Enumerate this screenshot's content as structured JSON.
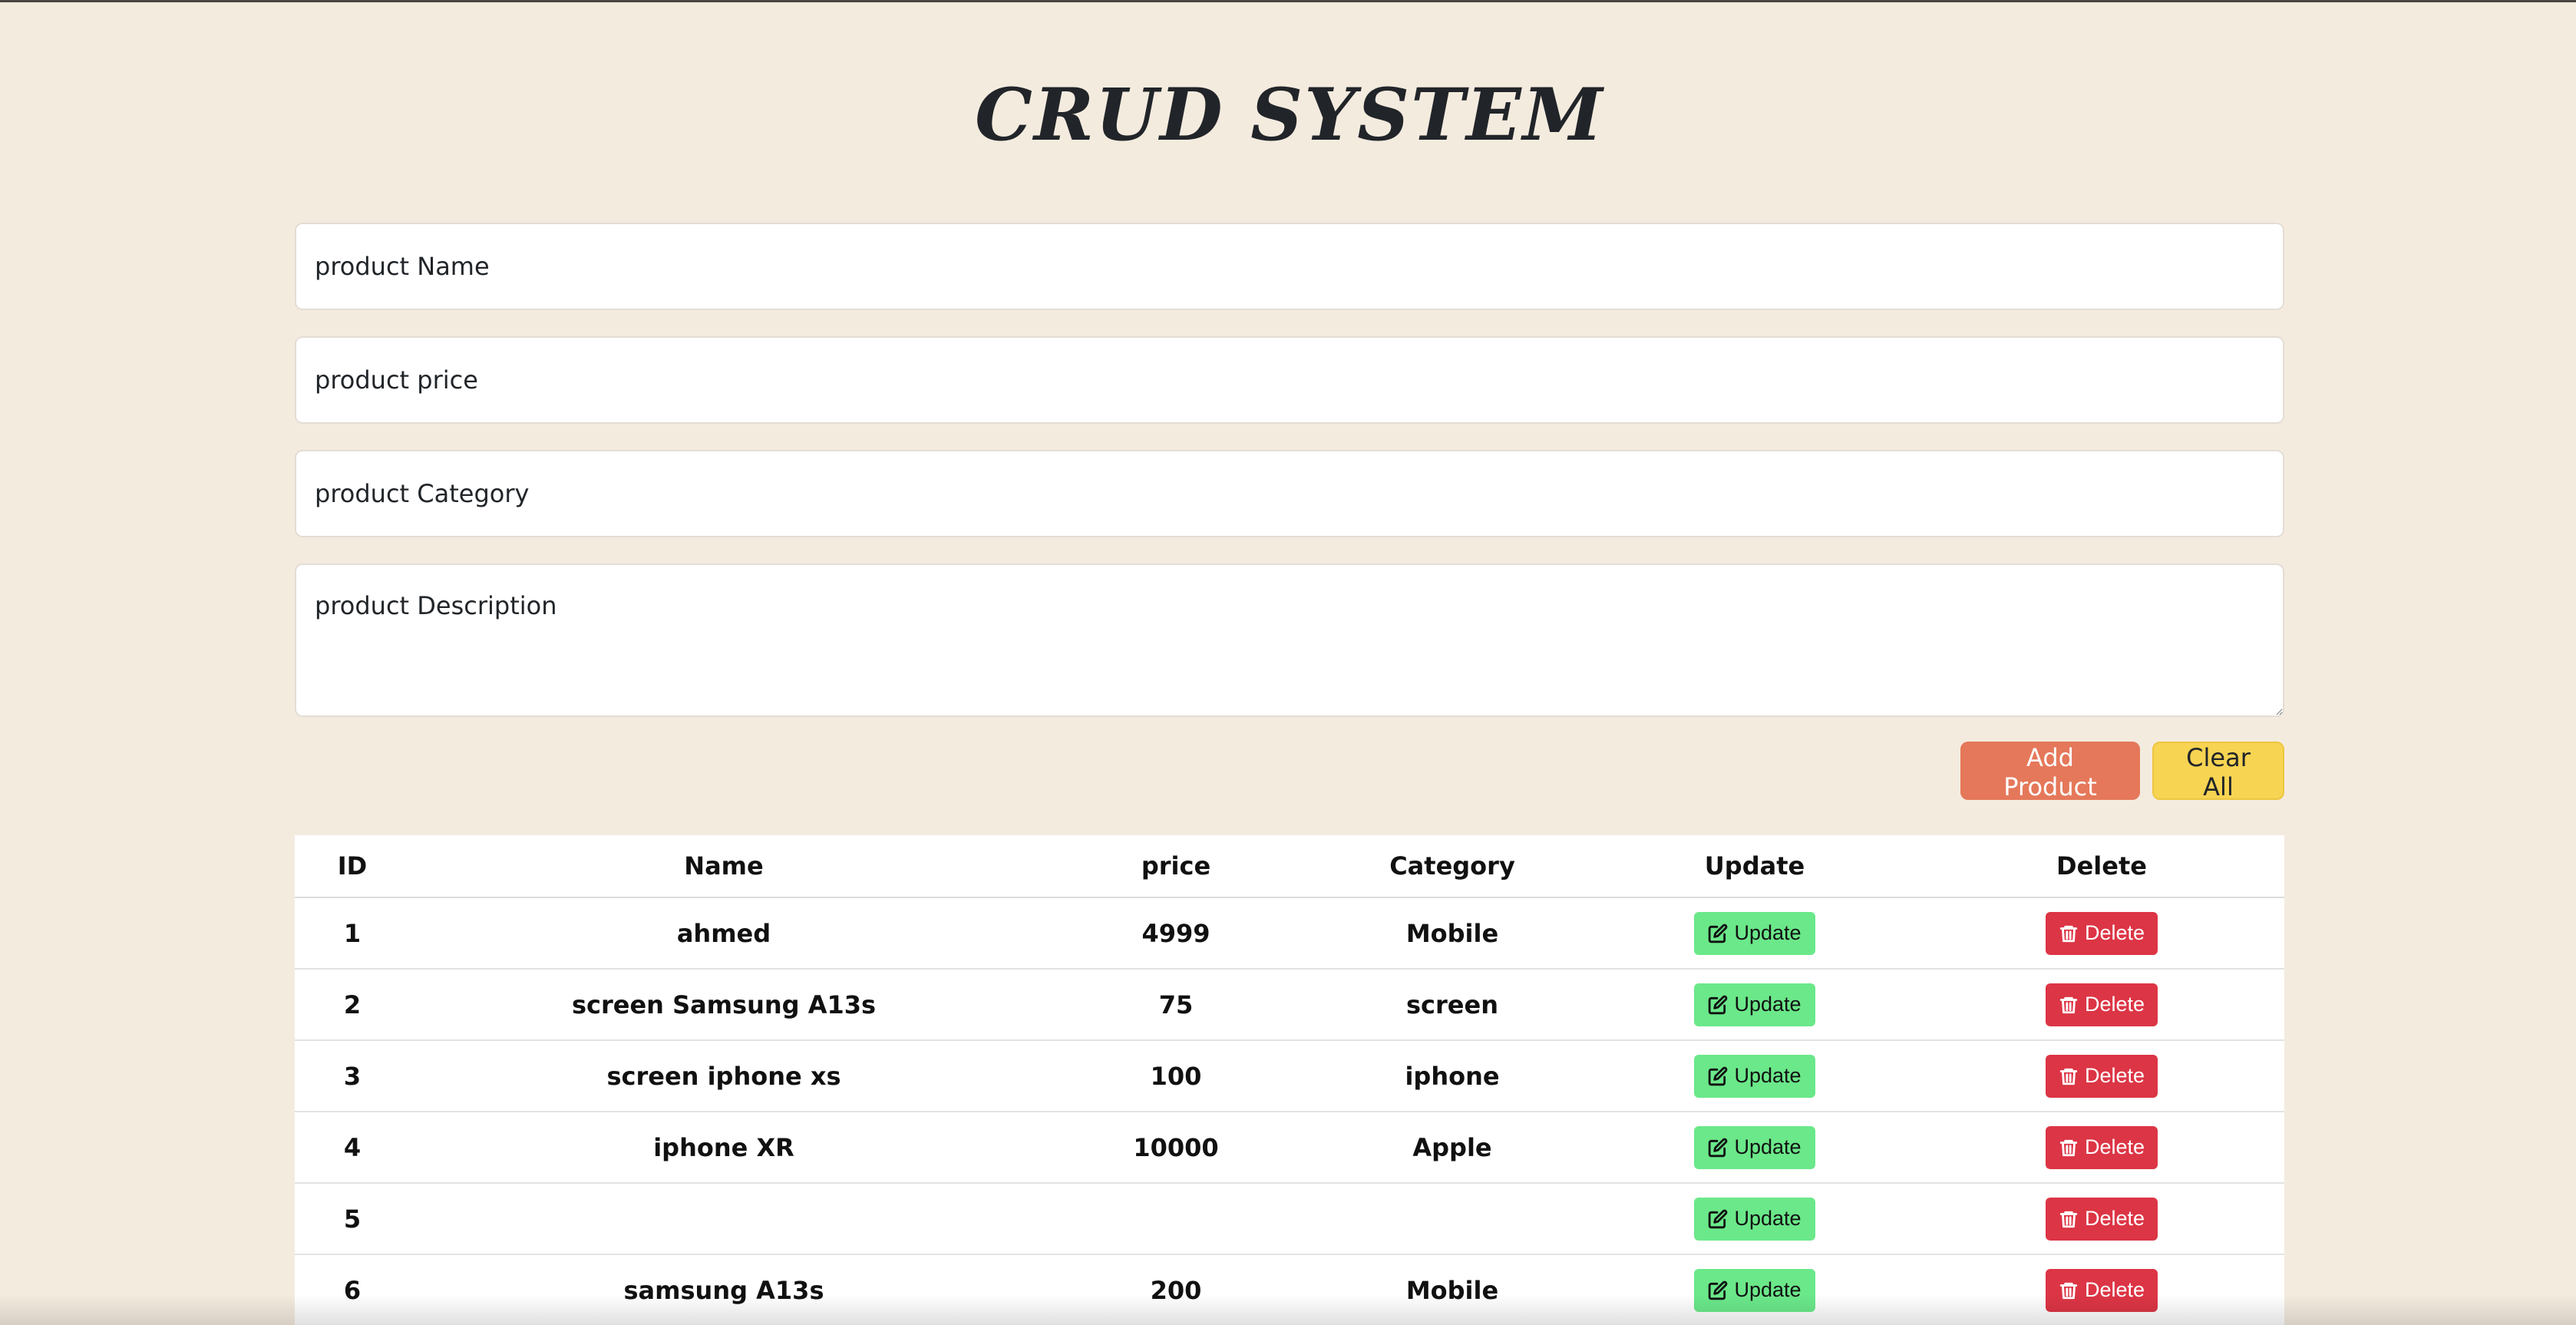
{
  "title": "CRUD SYSTEM",
  "form": {
    "name_placeholder": "product Name",
    "price_placeholder": "product price",
    "category_placeholder": "product Category",
    "description_placeholder": "product Description"
  },
  "buttons": {
    "add_label": "Add Product",
    "clear_label": "Clear All"
  },
  "table": {
    "headers": {
      "id": "ID",
      "name": "Name",
      "price": "price",
      "category": "Category",
      "update": "Update",
      "delete": "Delete"
    },
    "rows": [
      {
        "id": "1",
        "name": "ahmed",
        "price": "4999",
        "category": "Mobile",
        "update": "Update",
        "delete": "Delete"
      },
      {
        "id": "2",
        "name": "screen Samsung A13s",
        "price": "75",
        "category": "screen",
        "update": "Update",
        "delete": "Delete"
      },
      {
        "id": "3",
        "name": "screen iphone xs",
        "price": "100",
        "category": "iphone",
        "update": "Update",
        "delete": "Delete"
      },
      {
        "id": "4",
        "name": "iphone XR",
        "price": "10000",
        "category": "Apple",
        "update": "Update",
        "delete": "Delete"
      },
      {
        "id": "5",
        "name": "",
        "price": "",
        "category": "",
        "update": "Update",
        "delete": "Delete"
      },
      {
        "id": "6",
        "name": "samsung A13s",
        "price": "200",
        "category": "Mobile",
        "update": "Update",
        "delete": "Delete"
      }
    ]
  },
  "icons": {
    "update": "edit-icon",
    "delete": "trash-icon"
  },
  "colors": {
    "background": "#f4ebdf",
    "add_button": "#e5785a",
    "clear_button": "#f7d452",
    "update_button": "#6be88a",
    "delete_button": "#dc3545"
  }
}
